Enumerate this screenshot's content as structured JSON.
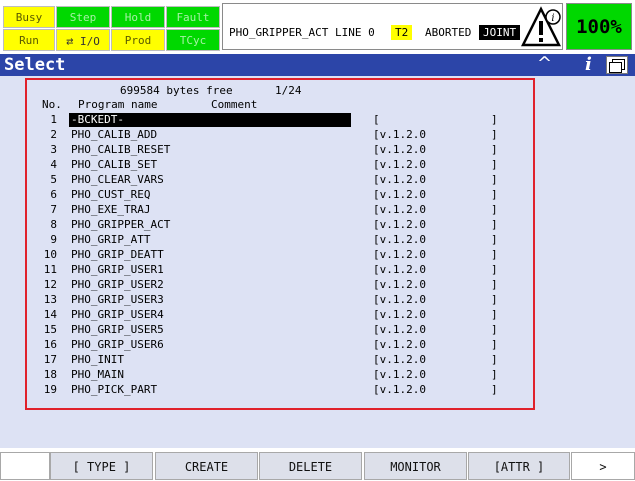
{
  "status_lamps": {
    "busy": "Busy",
    "step": "Step",
    "hold": "Hold",
    "fault": "Fault",
    "run": "Run",
    "io": "I/O",
    "prod": "Prod",
    "tcyc": "TCyc"
  },
  "status_panel": {
    "program_line": "PHO_GRIPPER_ACT LINE 0",
    "mode": "T2",
    "state": "ABORTED",
    "coord": "JOINT"
  },
  "override": "100%",
  "title": "Select",
  "list_header": {
    "bytes_free": "699584 bytes free",
    "page": "1/24",
    "col_no": "No.",
    "col_name": "Program name",
    "col_comment": "Comment"
  },
  "programs": [
    {
      "no": "1",
      "name": "-BCKEDT-",
      "comment": "[",
      "end": "]"
    },
    {
      "no": "2",
      "name": "PHO_CALIB_ADD",
      "comment": "[v.1.2.0",
      "end": "]"
    },
    {
      "no": "3",
      "name": "PHO_CALIB_RESET",
      "comment": "[v.1.2.0",
      "end": "]"
    },
    {
      "no": "4",
      "name": "PHO_CALIB_SET",
      "comment": "[v.1.2.0",
      "end": "]"
    },
    {
      "no": "5",
      "name": "PHO_CLEAR_VARS",
      "comment": "[v.1.2.0",
      "end": "]"
    },
    {
      "no": "6",
      "name": "PHO_CUST_REQ",
      "comment": "[v.1.2.0",
      "end": "]"
    },
    {
      "no": "7",
      "name": "PHO_EXE_TRAJ",
      "comment": "[v.1.2.0",
      "end": "]"
    },
    {
      "no": "8",
      "name": "PHO_GRIPPER_ACT",
      "comment": "[v.1.2.0",
      "end": "]"
    },
    {
      "no": "9",
      "name": "PHO_GRIP_ATT",
      "comment": "[v.1.2.0",
      "end": "]"
    },
    {
      "no": "10",
      "name": "PHO_GRIP_DEATT",
      "comment": "[v.1.2.0",
      "end": "]"
    },
    {
      "no": "11",
      "name": "PHO_GRIP_USER1",
      "comment": "[v.1.2.0",
      "end": "]"
    },
    {
      "no": "12",
      "name": "PHO_GRIP_USER2",
      "comment": "[v.1.2.0",
      "end": "]"
    },
    {
      "no": "13",
      "name": "PHO_GRIP_USER3",
      "comment": "[v.1.2.0",
      "end": "]"
    },
    {
      "no": "14",
      "name": "PHO_GRIP_USER4",
      "comment": "[v.1.2.0",
      "end": "]"
    },
    {
      "no": "15",
      "name": "PHO_GRIP_USER5",
      "comment": "[v.1.2.0",
      "end": "]"
    },
    {
      "no": "16",
      "name": "PHO_GRIP_USER6",
      "comment": "[v.1.2.0",
      "end": "]"
    },
    {
      "no": "17",
      "name": "PHO_INIT",
      "comment": "[v.1.2.0",
      "end": "]"
    },
    {
      "no": "18",
      "name": "PHO_MAIN",
      "comment": "[v.1.2.0",
      "end": "]"
    },
    {
      "no": "19",
      "name": "PHO_PICK_PART",
      "comment": "[v.1.2.0",
      "end": "]"
    }
  ],
  "function_keys": {
    "type": "[ TYPE ]",
    "create": "CREATE",
    "delete": "DELETE",
    "monitor": "MONITOR",
    "attr": "[ATTR ]",
    "next": ">"
  },
  "icons": {
    "io": "io-arrows-icon",
    "warning": "warning-triangle-icon",
    "info": "info-icon",
    "caret": "caret-up-icon",
    "window": "window-toggle-icon"
  },
  "colors": {
    "title_bar": "#2c45a8",
    "lamp_yellow": "#ffff00",
    "lamp_green": "#00d800",
    "selection_border": "#e0212b",
    "content_bg": "#dde2f4"
  }
}
